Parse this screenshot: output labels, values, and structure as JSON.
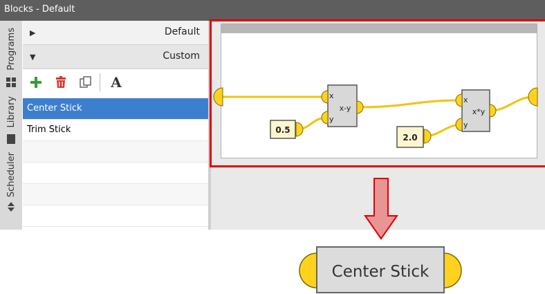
{
  "window": {
    "title": "Blocks - Default"
  },
  "side_tabs": [
    {
      "label": "Programs",
      "icon": "grid-icon"
    },
    {
      "label": "Library",
      "icon": "book-icon"
    },
    {
      "label": "Scheduler",
      "icon": "scheduler-icon"
    }
  ],
  "groups": [
    {
      "label": "Default",
      "expanded": false
    },
    {
      "label": "Custom",
      "expanded": true
    }
  ],
  "toolbar": {
    "add_icon": "plus-icon",
    "delete_icon": "trash-icon",
    "copy_icon": "copy-icon",
    "font_label": "A"
  },
  "blocks": [
    {
      "label": "Center Stick",
      "selected": true
    },
    {
      "label": "Trim Stick",
      "selected": false
    }
  ],
  "diagram": {
    "const_a": "0.5",
    "const_b": "2.0",
    "sub_block": {
      "in1": "x",
      "in2": "y",
      "label": "x-y"
    },
    "mul_block": {
      "in1": "x",
      "in2": "y",
      "label": "x*y"
    }
  },
  "result_block": {
    "label": "Center Stick"
  },
  "colors": {
    "accent": "#3d7fcf",
    "highlight": "#e00000",
    "port": "#ffd21f",
    "wire": "#f4c20d"
  }
}
